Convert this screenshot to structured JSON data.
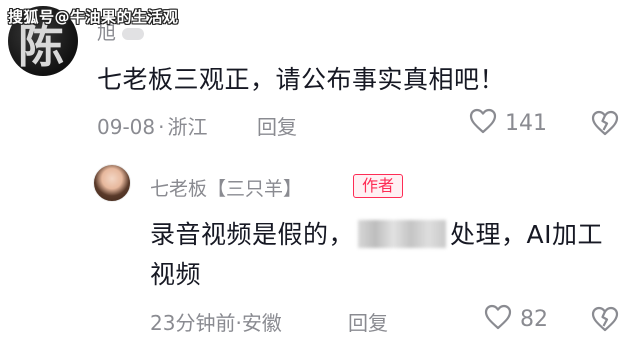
{
  "watermark": "搜狐号@牛油果的生活观",
  "comment": {
    "avatar_char": "陈",
    "username": "旭",
    "text": "七老板三观正，请公布事实真相吧！",
    "date": "09-08",
    "separator": "·",
    "location": "浙江",
    "reply_label": "回复",
    "like_count": "141"
  },
  "reply": {
    "username": "七老板【三只羊】",
    "author_tag": "作者",
    "text_before": "录音视频是假的，",
    "text_after": "处理，AI加工视频",
    "time": "23分钟前",
    "separator": "·",
    "location": "安徽",
    "reply_label": "回复",
    "like_count": "82"
  },
  "colors": {
    "primary_text": "#161823",
    "secondary_text": "#8a8b91",
    "author_tag": "#fe2c55"
  }
}
